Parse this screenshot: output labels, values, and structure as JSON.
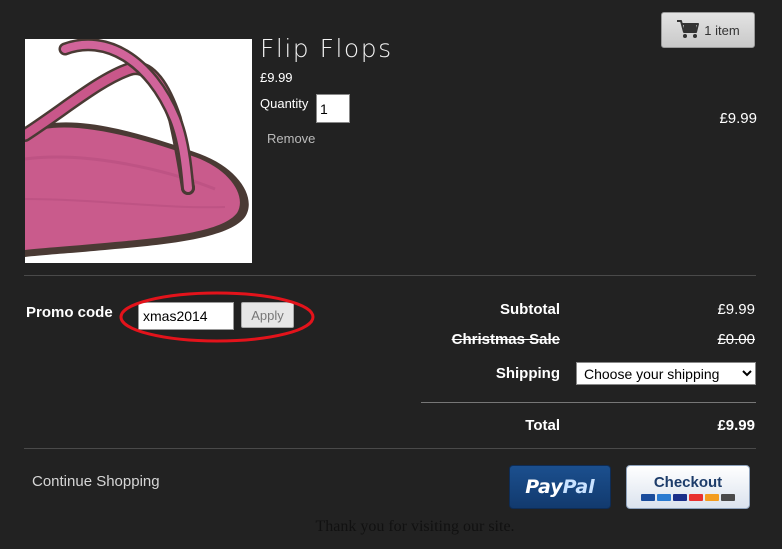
{
  "cart": {
    "count_label": "1 item",
    "icon": "cart-icon"
  },
  "product": {
    "title": "Flip Flops",
    "price": "£9.99",
    "quantity_label": "Quantity",
    "quantity_value": "1",
    "remove_label": "Remove",
    "line_total": "£9.99",
    "image": "pink-flip-flop-photo"
  },
  "promo": {
    "label": "Promo code",
    "code_value": "xmas2014",
    "apply_label": "Apply",
    "highlight_color": "#e3131b"
  },
  "totals": {
    "subtotal_label": "Subtotal",
    "subtotal_value": "£9.99",
    "discount_label": "Christmas Sale",
    "discount_value": "£0.00",
    "shipping_label": "Shipping",
    "shipping_selected": "Choose your shipping",
    "total_label": "Total",
    "total_value": "£9.99"
  },
  "footer": {
    "continue_label": "Continue Shopping",
    "paypal_pay": "Pay",
    "paypal_pal": "Pal",
    "checkout_label": "Checkout",
    "thanks": "Thank you for visiting our site."
  },
  "colors": {
    "background": "#222222",
    "paypal_blue": "#1b4f8e",
    "checkout_navy": "#1d3c6a"
  }
}
